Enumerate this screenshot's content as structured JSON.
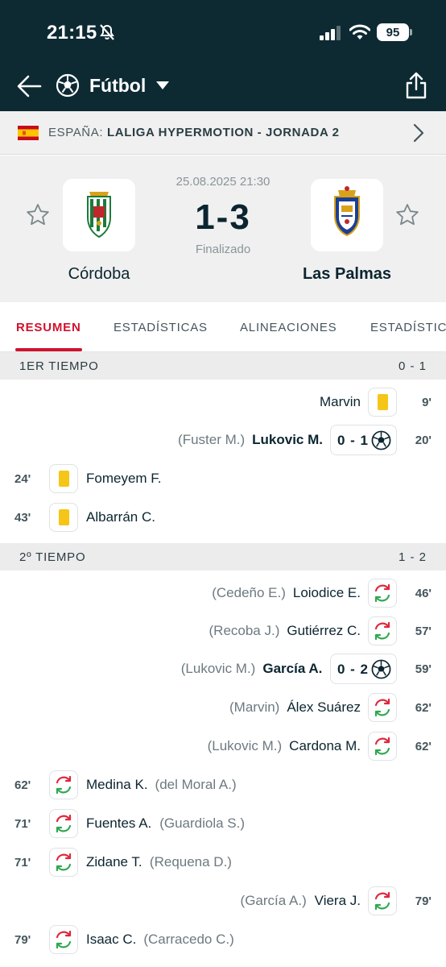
{
  "status_bar": {
    "time": "21:15",
    "battery": "95"
  },
  "header": {
    "sport": "Fútbol"
  },
  "league": {
    "country": "ESPAÑA:",
    "name": "LALIGA HYPERMOTION - JORNADA 2"
  },
  "match": {
    "datetime": "25.08.2025 21:30",
    "score": "1-3",
    "status": "Finalizado",
    "home": {
      "name": "Córdoba"
    },
    "away": {
      "name": "Las Palmas"
    }
  },
  "tabs": [
    "RESUMEN",
    "ESTADÍSTICAS",
    "ALINEACIONES",
    "ESTADÍSTICAS"
  ],
  "sections": [
    {
      "title": "1ER TIEMPO",
      "score": "0 - 1"
    },
    {
      "title": "2º TIEMPO",
      "score": "1 - 2"
    }
  ],
  "events": [
    {
      "minute": "9'",
      "side": "away",
      "type": "yellow",
      "player": "Marvin",
      "assist": ""
    },
    {
      "minute": "20'",
      "side": "away",
      "type": "goal",
      "player": "Lukovic M.",
      "assist": "(Fuster M.)",
      "score": "0 - 1"
    },
    {
      "minute": "24'",
      "side": "home",
      "type": "yellow",
      "player": "Fomeyem F.",
      "assist": ""
    },
    {
      "minute": "43'",
      "side": "home",
      "type": "yellow",
      "player": "Albarrán C.",
      "assist": ""
    },
    {
      "minute": "46'",
      "side": "away",
      "type": "sub",
      "player": "Loiodice E.",
      "assist": "(Cedeño E.)"
    },
    {
      "minute": "57'",
      "side": "away",
      "type": "sub",
      "player": "Gutiérrez C.",
      "assist": "(Recoba J.)"
    },
    {
      "minute": "59'",
      "side": "away",
      "type": "goal",
      "player": "García A.",
      "assist": "(Lukovic M.)",
      "score": "0 - 2"
    },
    {
      "minute": "62'",
      "side": "away",
      "type": "sub",
      "player": "Álex Suárez",
      "assist": "(Marvin)"
    },
    {
      "minute": "62'",
      "side": "away",
      "type": "sub",
      "player": "Cardona M.",
      "assist": "(Lukovic M.)"
    },
    {
      "minute": "62'",
      "side": "home",
      "type": "sub",
      "player": "Medina K.",
      "assist": "(del Moral A.)"
    },
    {
      "minute": "71'",
      "side": "home",
      "type": "sub",
      "player": "Fuentes A.",
      "assist": "(Guardiola S.)"
    },
    {
      "minute": "71'",
      "side": "home",
      "type": "sub",
      "player": "Zidane T.",
      "assist": "(Requena D.)"
    },
    {
      "minute": "79'",
      "side": "away",
      "type": "sub",
      "player": "Viera J.",
      "assist": "(García A.)"
    },
    {
      "minute": "79'",
      "side": "home",
      "type": "sub",
      "player": "Isaac C.",
      "assist": "(Carracedo C.)"
    }
  ]
}
